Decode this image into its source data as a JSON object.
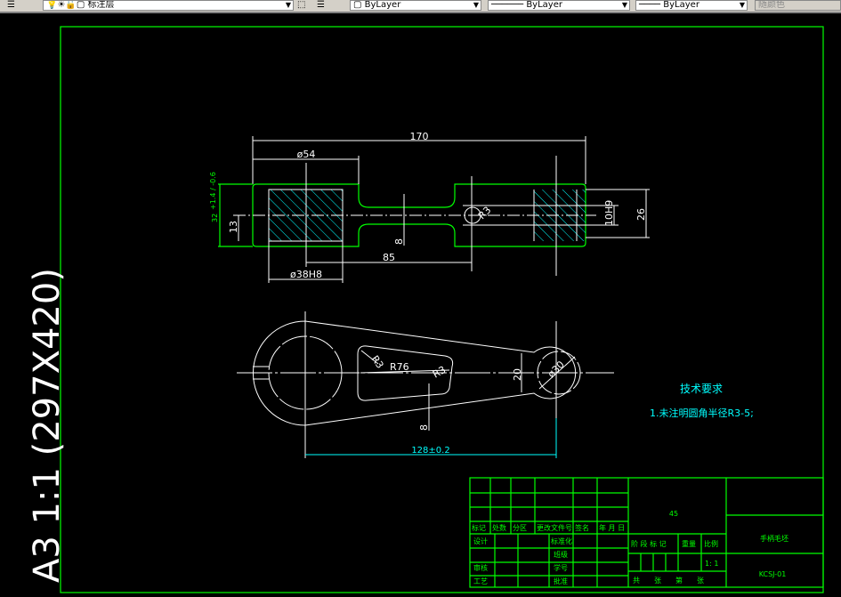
{
  "toolbar": {
    "layer_name": "标注层",
    "color": "ByLayer",
    "linetype": "ByLayer",
    "lineweight": "ByLayer",
    "plot_style": "随颜色"
  },
  "sheet": {
    "format_label": "A3 1:1 (297X420)"
  },
  "front_view": {
    "dims": {
      "overall": "170",
      "d54": "ø54",
      "d38": "ø38H8",
      "center": "85",
      "thick": "32",
      "tol": "+1.4 / -0.6",
      "h13": "13",
      "h8": "8",
      "h10": "10H9",
      "h26": "26",
      "r": "R3"
    }
  },
  "top_view": {
    "dims": {
      "r76": "R76",
      "r3a": "R3",
      "r3b": "R3",
      "w20": "20",
      "d30": "ø30",
      "t8": "8",
      "span": "128±0.2"
    }
  },
  "notes": {
    "title": "技术要求",
    "item1": "1.未注明圆角半径R3-5;"
  },
  "title_block": {
    "change_headers": [
      "标记",
      "处数",
      "分区",
      "更改文件号",
      "签名",
      "年 月 日"
    ],
    "design": "设计",
    "standard": "标准化",
    "class": "班级",
    "review": "审核",
    "student_no": "学号",
    "process": "工艺",
    "approve": "批准",
    "material": "45",
    "stage": "阶 段 标 记",
    "weight": "重量",
    "scale_label": "比例",
    "scale": "1: 1",
    "sheets": "共　　张　　第　　张",
    "part_name": "手柄毛坯",
    "drawing_no": "KCSJ-01"
  }
}
